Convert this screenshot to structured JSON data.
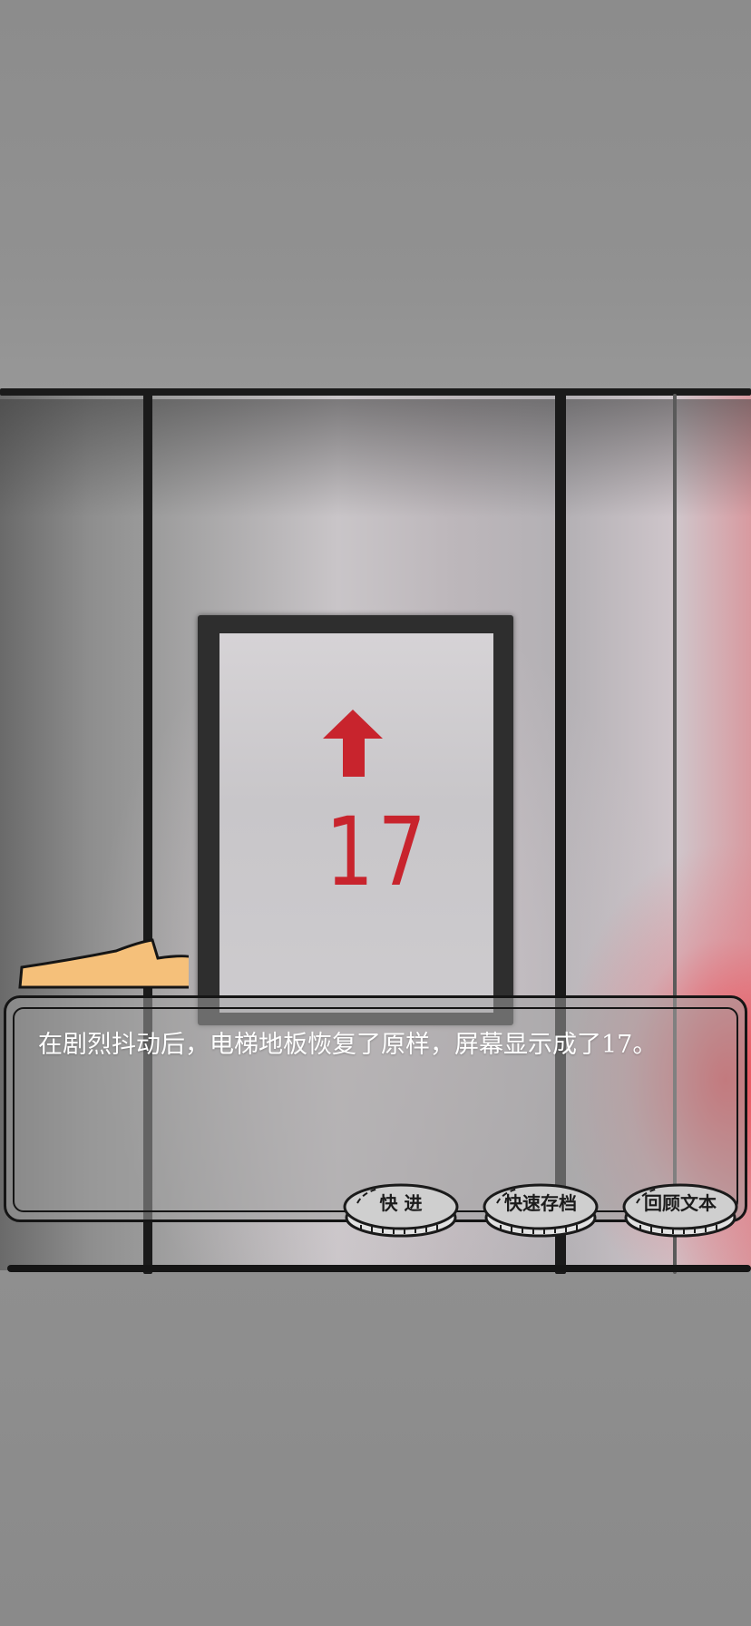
{
  "scene": {
    "floor_display": "17",
    "arrow_icon": "up-arrow-icon",
    "arrow_color": "#c8242d"
  },
  "dialog": {
    "text": "在剧烈抖动后，电梯地板恢复了原样，屏幕显示成了17。"
  },
  "buttons": {
    "fast_forward": "快  进",
    "quick_save": "快速存档",
    "review_text": "回顾文本"
  },
  "colors": {
    "nameplate": "#f5c07a",
    "dialog_border": "#151515",
    "text": "#ffffff"
  }
}
